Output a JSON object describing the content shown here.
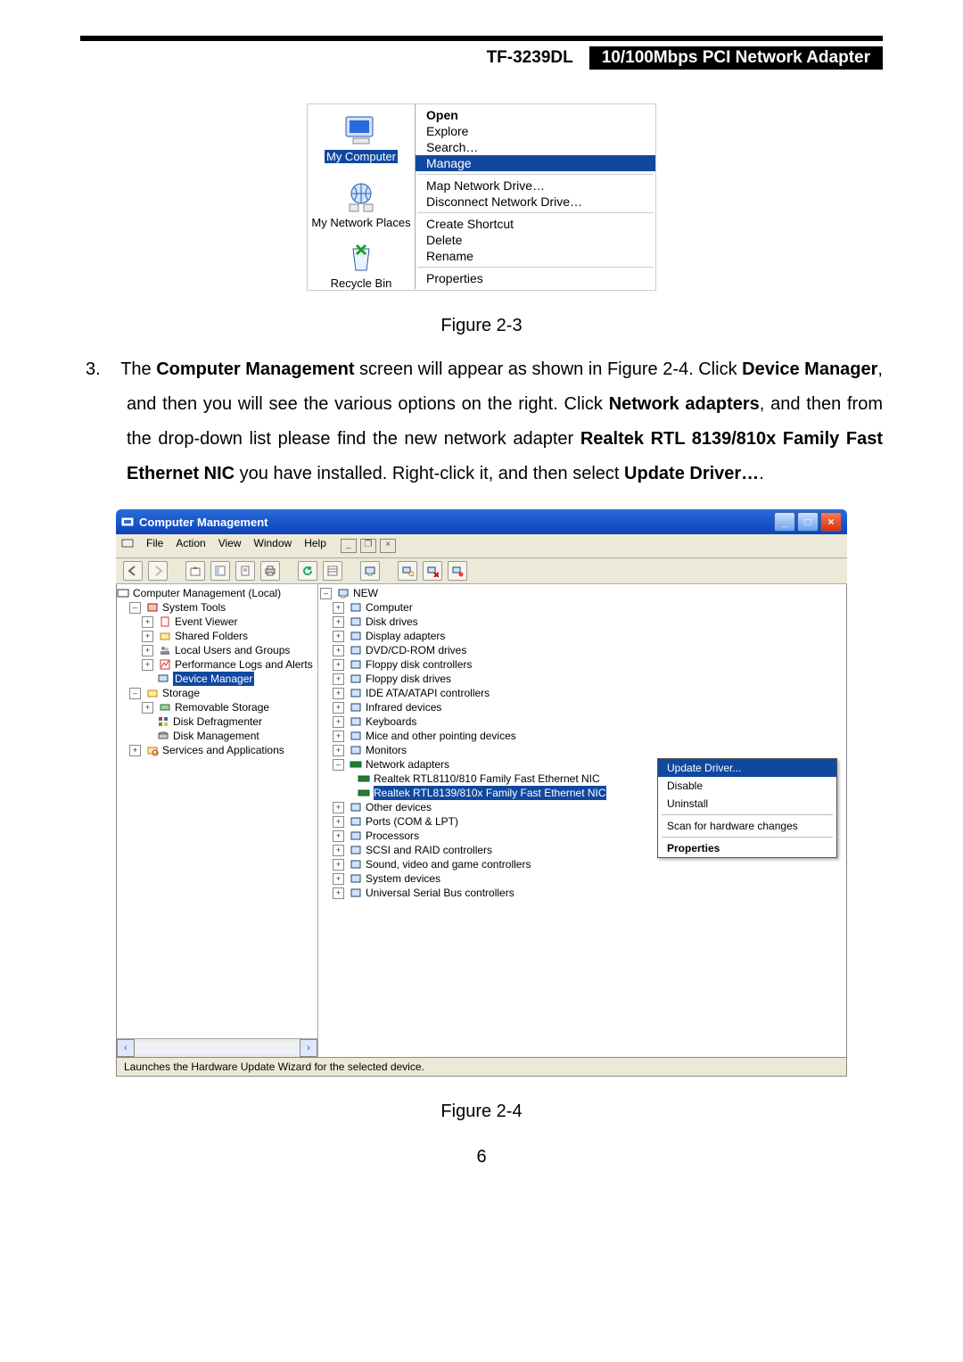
{
  "header": {
    "model": "TF-3239DL",
    "desc": "10/100Mbps PCI Network Adapter"
  },
  "fig1": {
    "desktop": {
      "mycomputer": "My Computer",
      "mynetwork": "My Network Places",
      "recycle": "Recycle Bin"
    },
    "menu": {
      "open": "Open",
      "explore": "Explore",
      "search": "Search…",
      "manage": "Manage",
      "map": "Map Network Drive…",
      "disc": "Disconnect Network Drive…",
      "shortcut": "Create Shortcut",
      "delete": "Delete",
      "rename": "Rename",
      "properties": "Properties"
    },
    "caption": "Figure 2-3"
  },
  "para": {
    "num": "3.",
    "t1": "The ",
    "b1": "Computer Management",
    "t2": " screen will appear as shown in Figure 2-4. Click ",
    "b2": "Device Manager",
    "t3": ", and then you will see the various options on the right. Click ",
    "b3": "Network adapters",
    "t4": ", and then from the drop-down list please find the new network adapter ",
    "b4": "Realtek RTL 8139/810x Family Fast Ethernet NIC",
    "t5": " you have installed. Right-click it, and then select ",
    "b5": "Update Driver…",
    "t6": "."
  },
  "cm": {
    "title": "Computer Management",
    "menu": {
      "file": "File",
      "action": "Action",
      "view": "View",
      "window": "Window",
      "help": "Help"
    },
    "mdibtn": {
      "min": "_",
      "restore": "❐",
      "close": "×"
    },
    "winbtn": {
      "min": "_",
      "max": "□",
      "close": "×"
    },
    "left": {
      "root": "Computer Management (Local)",
      "systools": "System Tools",
      "event": "Event Viewer",
      "shared": "Shared Folders",
      "users": "Local Users and Groups",
      "perf": "Performance Logs and Alerts",
      "devmgr": "Device Manager",
      "storage": "Storage",
      "remov": "Removable Storage",
      "defrag": "Disk Defragmenter",
      "diskmg": "Disk Management",
      "svcapp": "Services and Applications"
    },
    "right": {
      "root": "NEW",
      "items": [
        "Computer",
        "Disk drives",
        "Display adapters",
        "DVD/CD-ROM drives",
        "Floppy disk controllers",
        "Floppy disk drives",
        "IDE ATA/ATAPI controllers",
        "Infrared devices",
        "Keyboards",
        "Mice and other pointing devices",
        "Monitors"
      ],
      "netadapters": "Network adapters",
      "nic1": "Realtek RTL8110/810 Family Fast Ethernet NIC",
      "nic2": "Realtek RTL8139/810x Family Fast Ethernet NIC",
      "items2": [
        "Other devices",
        "Ports (COM & LPT)",
        "Processors",
        "SCSI and RAID controllers",
        "Sound, video and game controllers",
        "System devices",
        "Universal Serial Bus controllers"
      ]
    },
    "ctx": {
      "update": "Update Driver...",
      "disable": "Disable",
      "uninstall": "Uninstall",
      "scan": "Scan for hardware changes",
      "prop": "Properties"
    },
    "status": "Launches the Hardware Update Wizard for the selected device.",
    "caption": "Figure 2-4"
  },
  "page_number": "6"
}
